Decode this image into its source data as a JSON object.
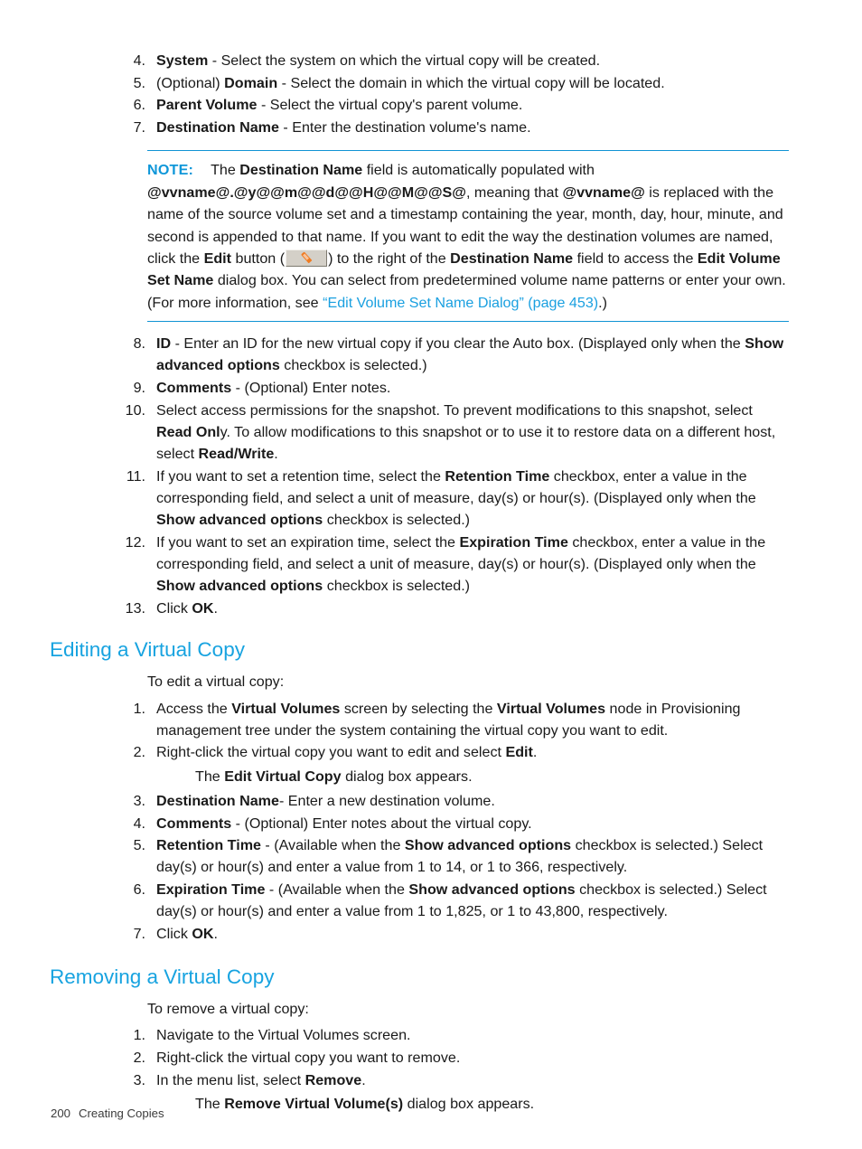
{
  "page": {
    "footer_page_number": "200",
    "footer_chapter": "Creating Copies",
    "accent_color": "#17a3e0",
    "link_color": "#1aa0e0",
    "note_rule_color": "#1093d4"
  },
  "steps_create": {
    "items": [
      {
        "num": "4.",
        "segments": [
          {
            "text": "System",
            "bold": true
          },
          {
            "text": " - Select the system on which the virtual copy will be created.",
            "bold": false
          }
        ]
      },
      {
        "num": "5.",
        "segments": [
          {
            "text": "(Optional) ",
            "bold": false
          },
          {
            "text": "Domain",
            "bold": true
          },
          {
            "text": " - Select the domain in which the virtual copy will be located.",
            "bold": false
          }
        ]
      },
      {
        "num": "6.",
        "segments": [
          {
            "text": "Parent Volume",
            "bold": true
          },
          {
            "text": " - Select the virtual copy's parent volume.",
            "bold": false
          }
        ]
      },
      {
        "num": "7.",
        "segments": [
          {
            "text": "Destination Name",
            "bold": true
          },
          {
            "text": " - Enter the destination volume's name.",
            "bold": false
          }
        ]
      }
    ]
  },
  "note": {
    "label": "NOTE:",
    "segments": [
      {
        "text": "The ",
        "bold": false
      },
      {
        "text": "Destination Name",
        "bold": true
      },
      {
        "text": " field is automatically populated with ",
        "bold": false
      },
      {
        "text": "@vvname@.@y@@m@@d@@H@@M@@S@",
        "bold": true
      },
      {
        "text": ", meaning that ",
        "bold": false
      },
      {
        "text": "@vvname@",
        "bold": true
      },
      {
        "text": " is replaced with the name of the source volume set and a timestamp containing the year, month, day, hour, minute, and second is appended to that name. If you want to edit the way the destination volumes are named, click the ",
        "bold": false
      },
      {
        "text": "Edit",
        "bold": true
      },
      {
        "text": " button (",
        "bold": false
      },
      {
        "icon": "edit-pencil-button-icon"
      },
      {
        "text": ") to the right of the ",
        "bold": false
      },
      {
        "text": "Destination Name",
        "bold": true
      },
      {
        "text": " field to access the ",
        "bold": false
      },
      {
        "text": "Edit Volume Set Name",
        "bold": true
      },
      {
        "text": " dialog box. You can select from predetermined volume name patterns or enter your own. (For more information, see ",
        "bold": false
      },
      {
        "text": "“Edit Volume Set Name Dialog” (page 453)",
        "link": true
      },
      {
        "text": ".)",
        "bold": false
      }
    ]
  },
  "steps_create_cont": {
    "items": [
      {
        "num": "8.",
        "segments": [
          {
            "text": "ID",
            "bold": true
          },
          {
            "text": " - Enter an ID for the new virtual copy if you clear the Auto box. (Displayed only when the ",
            "bold": false
          },
          {
            "text": "Show advanced options",
            "bold": true
          },
          {
            "text": " checkbox is selected.)",
            "bold": false
          }
        ]
      },
      {
        "num": "9.",
        "segments": [
          {
            "text": "Comments",
            "bold": true
          },
          {
            "text": " - (Optional) Enter notes.",
            "bold": false
          }
        ]
      },
      {
        "num": "10.",
        "segments": [
          {
            "text": "Select access permissions for the snapshot. To prevent modifications to this snapshot, select ",
            "bold": false
          },
          {
            "text": "Read Onl",
            "bold": true
          },
          {
            "text": "y. To allow modifications to this snapshot or to use it to restore data on a different host, select ",
            "bold": false
          },
          {
            "text": "Read/Write",
            "bold": true
          },
          {
            "text": ".",
            "bold": false
          }
        ]
      },
      {
        "num": "11.",
        "segments": [
          {
            "text": "If you want to set a retention time, select the ",
            "bold": false
          },
          {
            "text": "Retention Time",
            "bold": true
          },
          {
            "text": " checkbox, enter a value in the corresponding field, and select a unit of measure, day(s) or hour(s). (Displayed only when the ",
            "bold": false
          },
          {
            "text": "Show advanced options",
            "bold": true
          },
          {
            "text": " checkbox is selected.)",
            "bold": false
          }
        ]
      },
      {
        "num": "12.",
        "segments": [
          {
            "text": "If you want to set an expiration time, select the ",
            "bold": false
          },
          {
            "text": "Expiration Time",
            "bold": true
          },
          {
            "text": " checkbox, enter a value in the corresponding field, and select a unit of measure, day(s) or hour(s). (Displayed only when the ",
            "bold": false
          },
          {
            "text": "Show advanced options",
            "bold": true
          },
          {
            "text": " checkbox is selected.)",
            "bold": false
          }
        ]
      },
      {
        "num": "13.",
        "segments": [
          {
            "text": "Click ",
            "bold": false
          },
          {
            "text": "OK",
            "bold": true
          },
          {
            "text": ".",
            "bold": false
          }
        ]
      }
    ]
  },
  "section_editing": {
    "heading": "Editing a Virtual Copy",
    "intro": "To edit a virtual copy:",
    "items": [
      {
        "num": "1.",
        "segments": [
          {
            "text": "Access the ",
            "bold": false
          },
          {
            "text": "Virtual Volumes",
            "bold": true
          },
          {
            "text": " screen by selecting the ",
            "bold": false
          },
          {
            "text": "Virtual Volumes",
            "bold": true
          },
          {
            "text": " node in Provisioning management tree under the system containing the virtual copy you want to edit.",
            "bold": false
          }
        ]
      },
      {
        "num": "2.",
        "segments": [
          {
            "text": "Right-click the virtual copy you want to edit and select ",
            "bold": false
          },
          {
            "text": "Edit",
            "bold": true
          },
          {
            "text": ".",
            "bold": false
          }
        ],
        "sub_segments": [
          {
            "text": "The ",
            "bold": false
          },
          {
            "text": "Edit Virtual Copy",
            "bold": true
          },
          {
            "text": " dialog box appears.",
            "bold": false
          }
        ]
      },
      {
        "num": "3.",
        "segments": [
          {
            "text": "Destination Name",
            "bold": true
          },
          {
            "text": "- Enter a new destination volume.",
            "bold": false
          }
        ]
      },
      {
        "num": "4.",
        "segments": [
          {
            "text": "Comments",
            "bold": true
          },
          {
            "text": " - (Optional) Enter notes about the virtual copy.",
            "bold": false
          }
        ]
      },
      {
        "num": "5.",
        "segments": [
          {
            "text": "Retention Time",
            "bold": true
          },
          {
            "text": " - (Available when the ",
            "bold": false
          },
          {
            "text": "Show advanced options",
            "bold": true
          },
          {
            "text": " checkbox is selected.) Select day(s) or hour(s) and enter a value from 1 to 14, or 1 to 366, respectively.",
            "bold": false
          }
        ]
      },
      {
        "num": "6.",
        "segments": [
          {
            "text": "Expiration Time",
            "bold": true
          },
          {
            "text": " - (Available when the ",
            "bold": false
          },
          {
            "text": "Show advanced options",
            "bold": true
          },
          {
            "text": " checkbox is selected.) Select day(s) or hour(s) and enter a value from 1 to 1,825, or 1 to 43,800, respectively.",
            "bold": false
          }
        ]
      },
      {
        "num": "7.",
        "segments": [
          {
            "text": "Click ",
            "bold": false
          },
          {
            "text": "OK",
            "bold": true
          },
          {
            "text": ".",
            "bold": false
          }
        ]
      }
    ]
  },
  "section_removing": {
    "heading": "Removing a Virtual Copy",
    "intro": "To remove a virtual copy:",
    "items": [
      {
        "num": "1.",
        "segments": [
          {
            "text": "Navigate to the Virtual Volumes screen.",
            "bold": false
          }
        ]
      },
      {
        "num": "2.",
        "segments": [
          {
            "text": "Right-click the virtual copy you want to remove.",
            "bold": false
          }
        ]
      },
      {
        "num": "3.",
        "segments": [
          {
            "text": "In the menu list, select ",
            "bold": false
          },
          {
            "text": "Remove",
            "bold": true
          },
          {
            "text": ".",
            "bold": false
          }
        ],
        "sub_segments": [
          {
            "text": "The ",
            "bold": false
          },
          {
            "text": "Remove Virtual Volume(s)",
            "bold": true
          },
          {
            "text": " dialog box appears.",
            "bold": false
          }
        ]
      }
    ]
  }
}
